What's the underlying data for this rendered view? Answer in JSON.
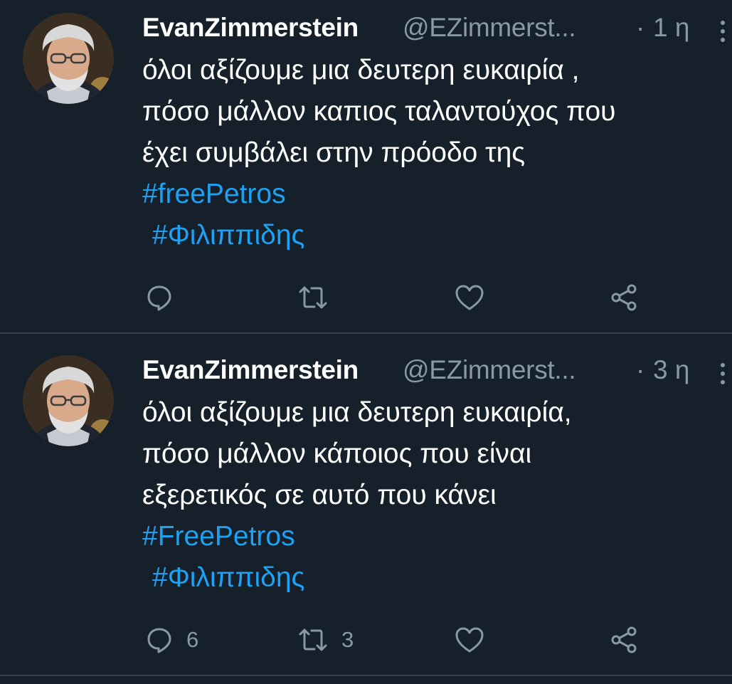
{
  "tweets": [
    {
      "author_name": "EvanZimmerstein",
      "handle": "@EZimmerst...",
      "separator": "·",
      "time": "1 η",
      "lines": [
        "όλοι αξίζουμε μια δευτερη ευκαιρία ,",
        "πόσο μάλλον καπιος ταλαντούχος που",
        "έχει συμβάλει στην πρόοδο της"
      ],
      "hashtags": [
        "#freePetros",
        "#Φιλιππιδης"
      ],
      "reply_count": "",
      "retweet_count": "",
      "like_count": ""
    },
    {
      "author_name": "EvanZimmerstein",
      "handle": "@EZimmerst...",
      "separator": "·",
      "time": "3 η",
      "lines": [
        "όλοι αξίζουμε μια δευτερη ευκαιρία,",
        "πόσο μάλλον κάποιος που είναι",
        "εξερετικός σε αυτό που κάνει"
      ],
      "hashtags": [
        "#FreePetros",
        "#Φιλιππιδης"
      ],
      "reply_count": "6",
      "retweet_count": "3",
      "like_count": ""
    }
  ],
  "icons": {
    "avatar": "avatar-portrait-icon",
    "more": "more-vertical-icon",
    "reply": "reply-bubble-icon",
    "retweet": "retweet-icon",
    "like": "heart-icon",
    "share": "share-icon"
  },
  "colors": {
    "background": "#15202b",
    "text": "#ffffff",
    "secondary": "#8899a6",
    "hashtag": "#1da1f2",
    "divider": "#38444d"
  }
}
